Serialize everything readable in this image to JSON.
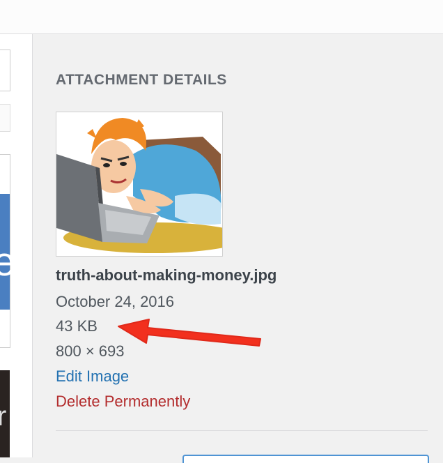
{
  "panel": {
    "heading": "ATTACHMENT DETAILS",
    "filename": "truth-about-making-money.jpg",
    "date": "October 24, 2016",
    "filesize": "43 KB",
    "dimensions": "800 × 693",
    "edit_label": "Edit Image",
    "delete_label": "Delete Permanently"
  },
  "colors": {
    "link": "#2271b1",
    "delete": "#b32d2e",
    "arrow": "#f2301e"
  }
}
